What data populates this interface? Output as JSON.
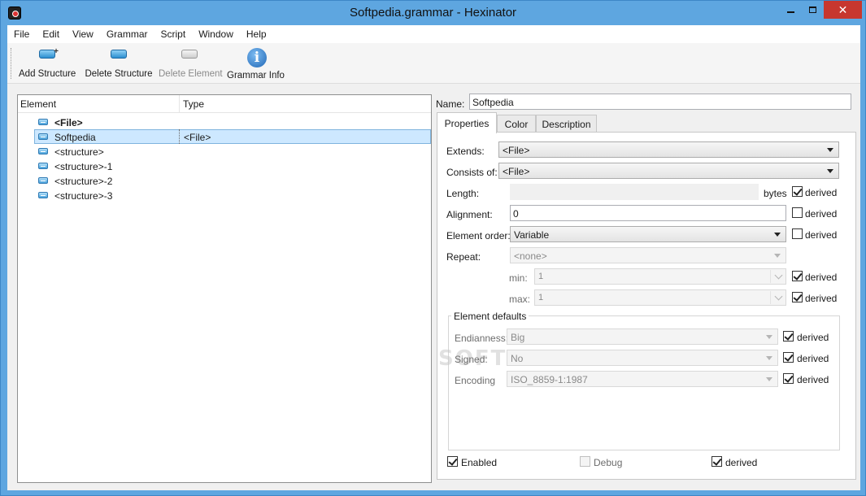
{
  "window": {
    "title": "Softpedia.grammar - Hexinator"
  },
  "menu": [
    "File",
    "Edit",
    "View",
    "Grammar",
    "Script",
    "Window",
    "Help"
  ],
  "toolbar": {
    "add_structure": "Add Structure",
    "delete_structure": "Delete Structure",
    "delete_element": "Delete Element",
    "grammar_info": "Grammar Info",
    "info_glyph": "i"
  },
  "tree": {
    "headers": {
      "element": "Element",
      "type": "Type"
    },
    "rows": [
      {
        "name": "<File>",
        "type": ""
      },
      {
        "name": "Softpedia",
        "type": "<File>"
      },
      {
        "name": "<structure>",
        "type": ""
      },
      {
        "name": "<structure>-1",
        "type": ""
      },
      {
        "name": "<structure>-2",
        "type": ""
      },
      {
        "name": "<structure>-3",
        "type": ""
      }
    ]
  },
  "properties": {
    "name_label": "Name:",
    "name_value": "Softpedia",
    "tabs": [
      "Properties",
      "Color",
      "Description"
    ],
    "extends_label": "Extends:",
    "extends_value": "<File>",
    "consists_label": "Consists of:",
    "consists_value": "<File>",
    "length_label": "Length:",
    "length_unit": "bytes",
    "alignment_label": "Alignment:",
    "alignment_value": "0",
    "order_label": "Element order:",
    "order_value": "Variable",
    "repeat_label": "Repeat:",
    "repeat_value": "<none>",
    "min_label": "min:",
    "min_value": "1",
    "max_label": "max:",
    "max_value": "1",
    "derived": "derived",
    "defaults_title": "Element defaults",
    "endianness_label": "Endianness:",
    "endianness_value": "Big",
    "signed_label": "Signed:",
    "signed_value": "No",
    "encoding_label": "Encoding",
    "encoding_value": "ISO_8859-1:1987",
    "enabled_label": "Enabled",
    "debug_label": "Debug"
  },
  "watermark": "SOFTPEDIA"
}
